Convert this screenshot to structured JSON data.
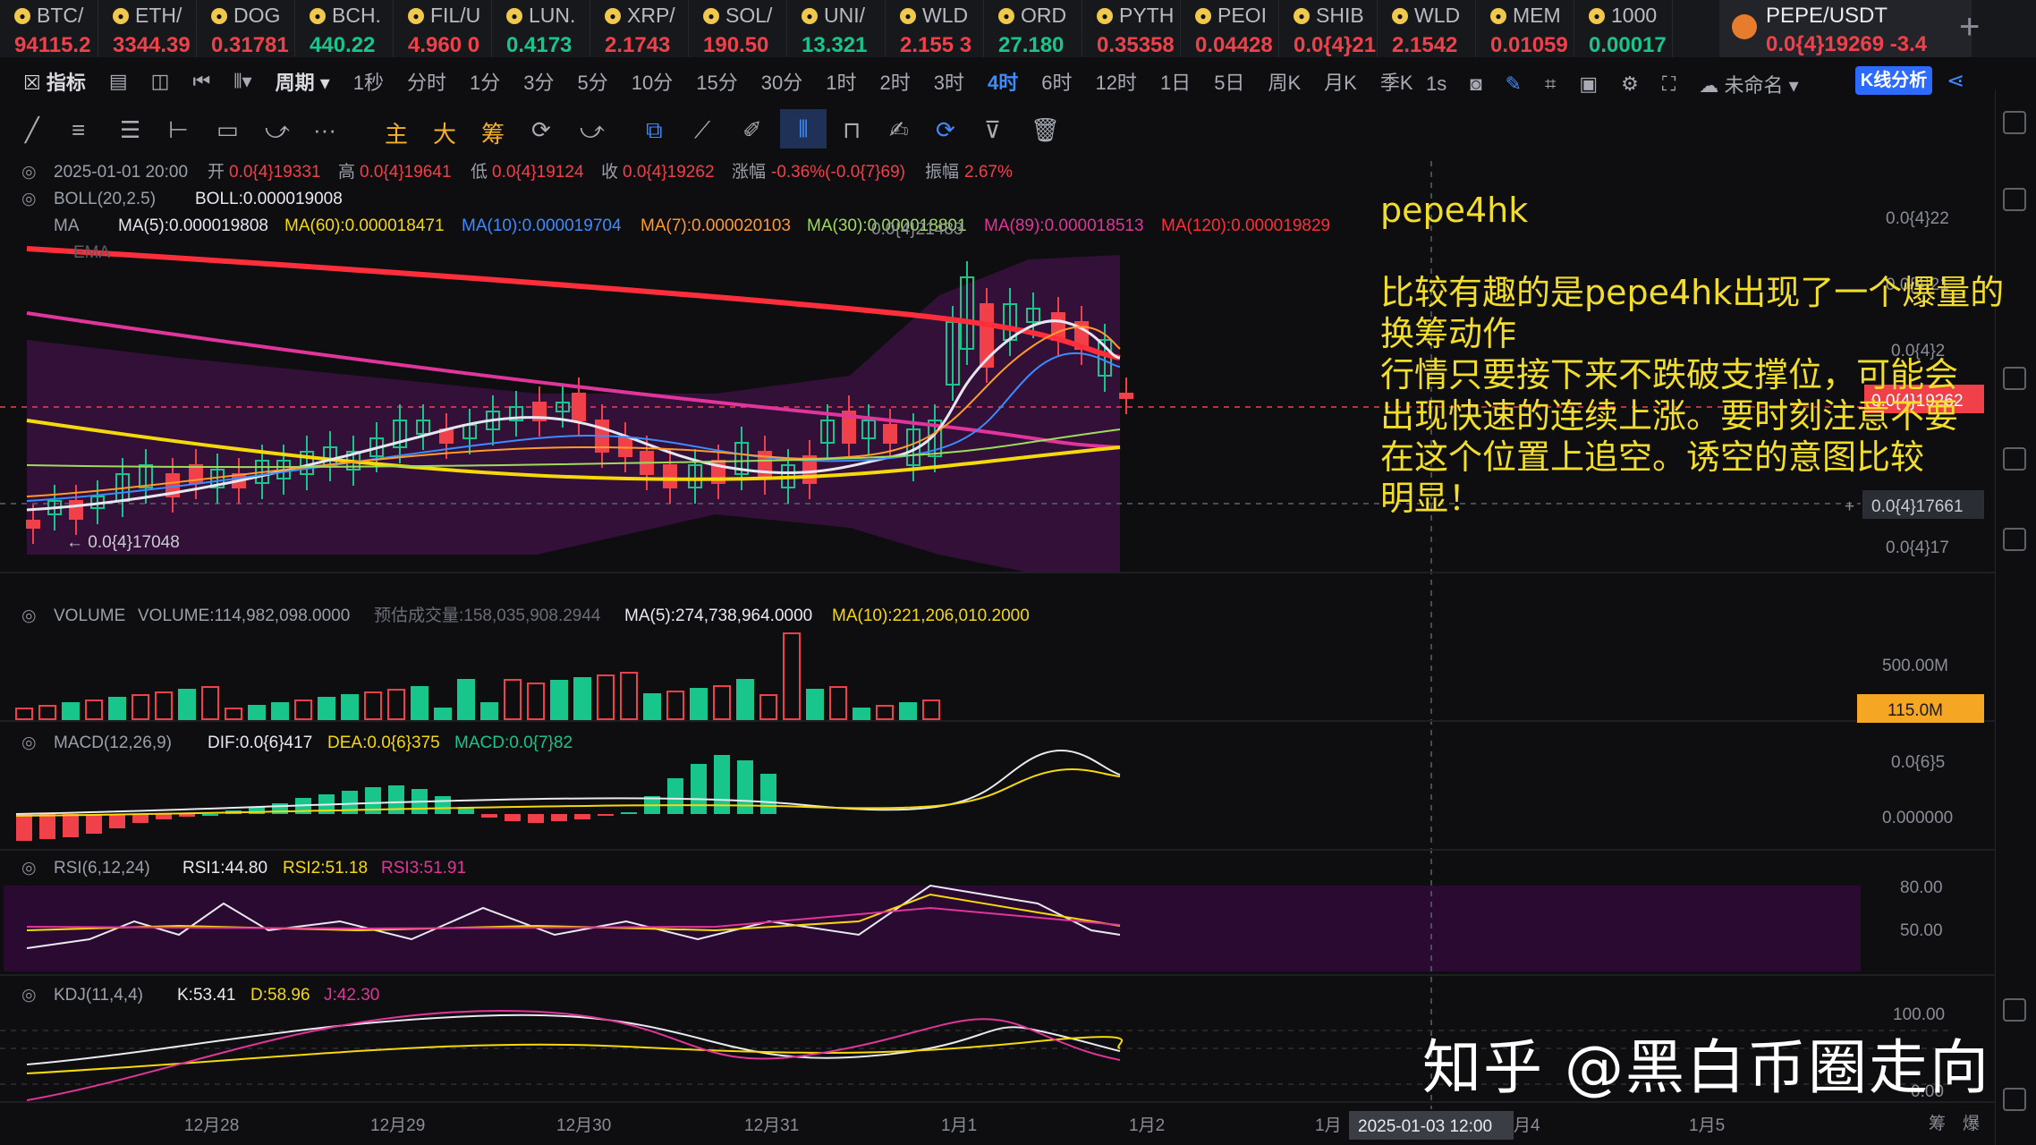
{
  "tickers": [
    {
      "name": "BTC/",
      "price": "94115.2",
      "trend": "dn"
    },
    {
      "name": "ETH/",
      "price": "3344.39",
      "trend": "dn"
    },
    {
      "name": "DOG",
      "price": "0.31781",
      "trend": "dn"
    },
    {
      "name": "BCH.",
      "price": "440.22",
      "trend": "up"
    },
    {
      "name": "FIL/U",
      "price": "4.960 0",
      "trend": "dn"
    },
    {
      "name": "LUN.",
      "price": "0.4173",
      "trend": "up"
    },
    {
      "name": "XRP/",
      "price": "2.1743",
      "trend": "dn"
    },
    {
      "name": "SOL/",
      "price": "190.50",
      "trend": "dn"
    },
    {
      "name": "UNI/",
      "price": "13.321",
      "trend": "up"
    },
    {
      "name": "WLD",
      "price": "2.155 3",
      "trend": "dn"
    },
    {
      "name": "ORD",
      "price": "27.180",
      "trend": "up"
    },
    {
      "name": "PYTH",
      "price": "0.35358",
      "trend": "dn"
    },
    {
      "name": "PEOI",
      "price": "0.04428",
      "trend": "dn"
    },
    {
      "name": "SHIB",
      "price": "0.0{4}21",
      "trend": "dn"
    },
    {
      "name": "WLD",
      "price": "2.1542",
      "trend": "dn"
    },
    {
      "name": "MEM",
      "price": "0.01059",
      "trend": "dn"
    },
    {
      "name": "1000",
      "price": "0.00017",
      "trend": "up"
    }
  ],
  "active_ticker": {
    "name": "PEPE/USDT",
    "price": "0.0{4}19269  -3.4"
  },
  "toolbar": {
    "indicator": "指标",
    "period": "周期",
    "intervals": [
      "1秒",
      "分时",
      "1分",
      "3分",
      "5分",
      "10分",
      "15分",
      "30分",
      "1时",
      "2时",
      "3时",
      "4时",
      "6时",
      "12时",
      "1日",
      "5日",
      "周K",
      "月K",
      "季K"
    ],
    "active_interval": "4时",
    "right_1s": "1s",
    "unnamed": "未命名",
    "kline_analysis": "K线分析"
  },
  "drawing_tools": {
    "main": "主",
    "big": "大",
    "chips": "筹"
  },
  "info": {
    "date": "2025-01-01 20:00",
    "open_l": "开",
    "open": "0.0{4}19331",
    "high_l": "高",
    "high": "0.0{4}19641",
    "low_l": "低",
    "low": "0.0{4}19124",
    "close_l": "收",
    "close": "0.0{4}19262",
    "chg_l": "涨幅",
    "chg": "-0.36%(-0.0{7}69)",
    "amp_l": "振幅",
    "amp": "2.67%"
  },
  "boll": {
    "label": "BOLL(20,2.5)",
    "value": "BOLL:0.000019008"
  },
  "ma": {
    "label": "MA",
    "ma5": "MA(5):0.000019808",
    "ma60": "MA(60):0.000018471",
    "ma10": "MA(10):0.000019704",
    "ma7": "MA(7):0.000020103",
    "ma30": "MA(30):0.000018801",
    "ma89": "MA(89):0.000018513",
    "ma120": "MA(120):0.000019829"
  },
  "ema_label": "EMA",
  "overlap_text": "0.0{4}21483",
  "low_marker": "← 0.0{4}17048",
  "price_axis": [
    "0.0{4}22",
    "0.0{4}21",
    "0.0{4}2",
    "0.0{4}17661",
    "0.0{4}17"
  ],
  "last_price_tag": "0.0{4}19262",
  "volume": {
    "label": "VOLUME",
    "vol": "VOLUME:114,982,098.0000",
    "est": "预估成交量:158,035,908.2944",
    "ma5": "MA(5):274,738,964.0000",
    "ma10": "MA(10):221,206,010.2000",
    "axis": "500.00M",
    "tag": "115.0M"
  },
  "macd": {
    "label": "MACD(12,26,9)",
    "dif": "DIF:0.0{6}417",
    "dea": "DEA:0.0{6}375",
    "macd": "MACD:0.0{7}82",
    "axis1": "0.0{6}5",
    "axis2": "0.000000"
  },
  "rsi": {
    "label": "RSI(6,12,24)",
    "r1": "RSI1:44.80",
    "r2": "RSI2:51.18",
    "r3": "RSI3:51.91",
    "axis1": "80.00",
    "axis2": "50.00"
  },
  "kdj": {
    "label": "KDJ(11,4,4)",
    "k": "K:53.41",
    "d": "D:58.96",
    "j": "J:42.30",
    "axis1": "100.00",
    "axis2": "0.00"
  },
  "x_axis": [
    "12月28",
    "12月29",
    "12月30",
    "12月31",
    "1月1",
    "1月2",
    "1月",
    "月4",
    "1月5"
  ],
  "crosshair_date": "2025-01-03 12:00",
  "bottom_right": [
    "筹",
    "爆"
  ],
  "annotation": {
    "title": "pepe4hk",
    "lines": [
      "比较有趣的是pepe4hk出现了一个爆量的",
      "换筹动作",
      "行情只要接下来不跌破支撑位，可能会",
      "出现快速的连续上涨。要时刻注意不要",
      "在这个位置上追空。诱空的意图比较",
      "明显！"
    ]
  },
  "watermark": "知乎 @黑白币圈走向",
  "colors": {
    "up": "#18c58a",
    "down": "#f0414b",
    "ma120": "#ff2e3a",
    "ma89": "#e0359a",
    "ma60": "#f5d90a",
    "ma5": "#e6e6f0",
    "ma10": "#3d8bff",
    "ma7": "#ff9b2b",
    "ma30": "#9ddc5a",
    "boll_fill": "#3a1040",
    "annotation": "#f2dd2c"
  }
}
